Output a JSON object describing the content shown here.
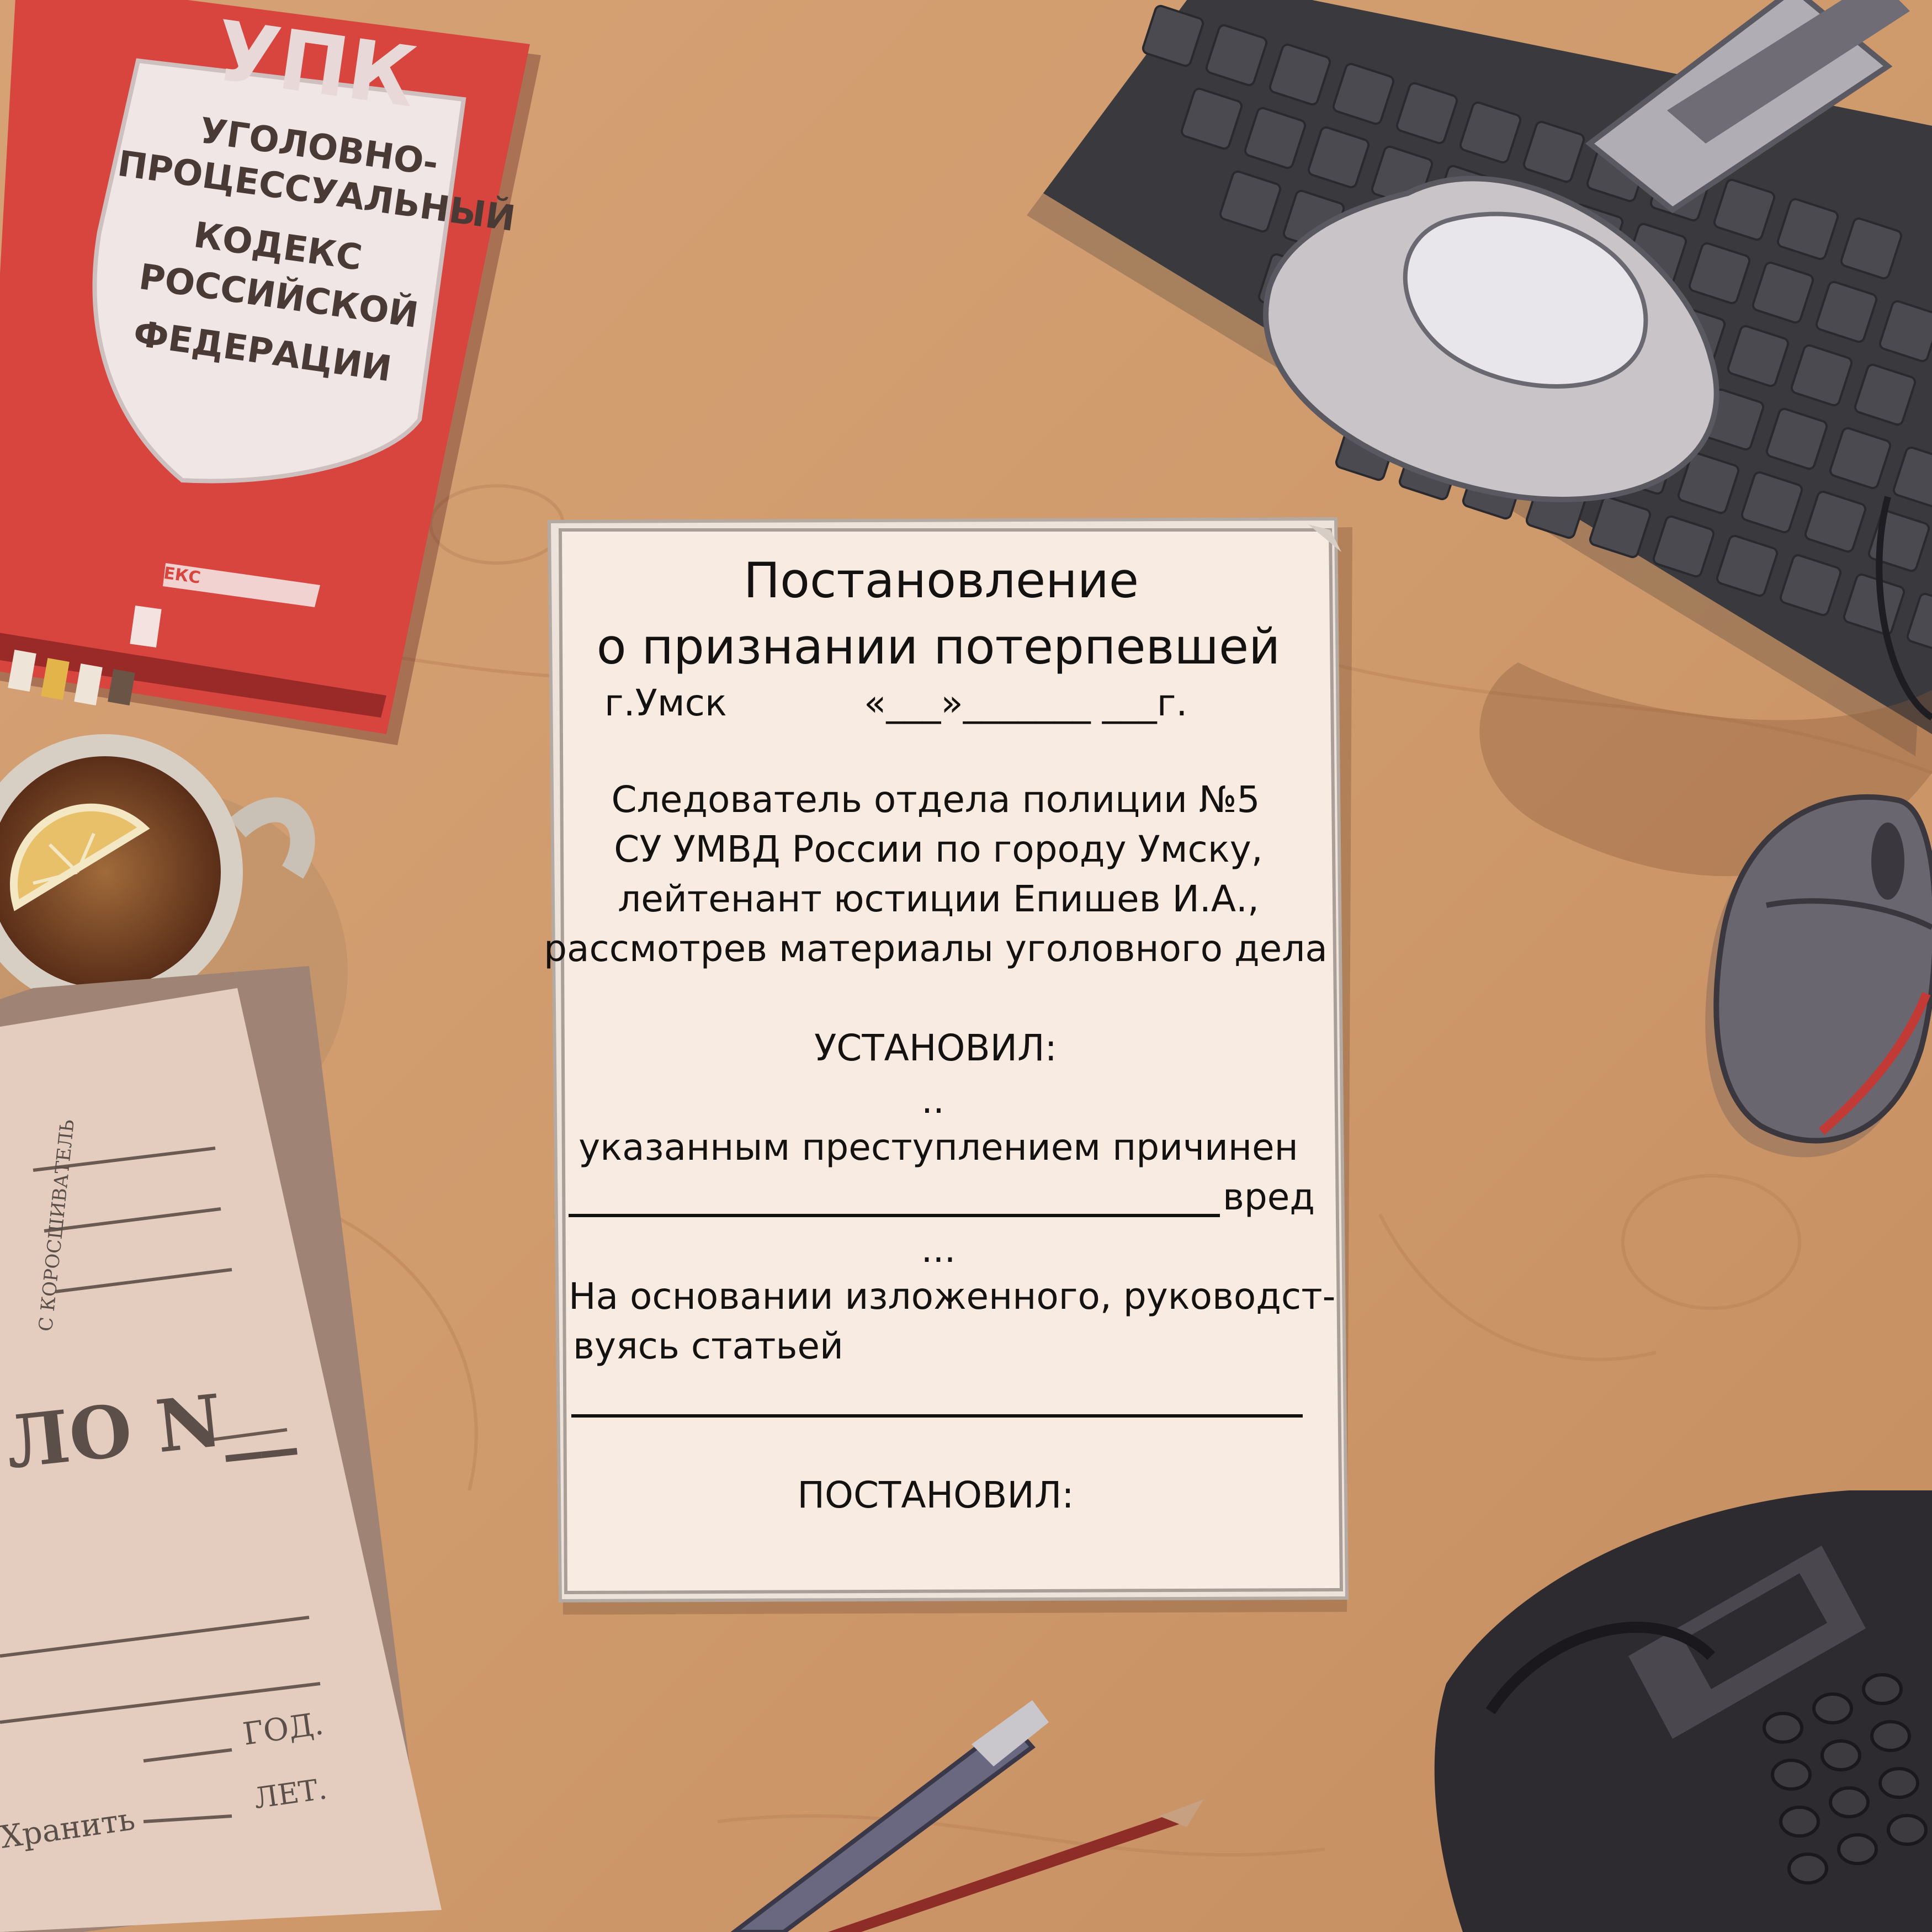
{
  "document": {
    "title_line1": "Постановление",
    "title_line2": "о признании потерпевшей",
    "city": "г.Умск",
    "date_template": "«___»_______ ___г.",
    "intro_lines": [
      "Следователь отдела полиции №5",
      "СУ УМВД России по городу Умску,",
      "лейтенант юстиции Епишев И.А.,",
      "рассмотрев материалы уголовного дела"
    ],
    "established_heading": "УСТАНОВИЛ:",
    "ellipsis_short": "..",
    "harm_line": "указанным преступлением причинен",
    "harm_word": "вред",
    "ellipsis_long": "...",
    "basis_line1": "На основании изложенного, руководст-",
    "basis_line2": "вуясь статьей",
    "decreed_heading": "ПОСТАНОВИЛ:"
  },
  "codebook": {
    "abbr": "УПК",
    "title_lines": [
      "УГОЛОВНО-",
      "ПРОЦЕССУАЛЬНЫЙ",
      "КОДЕКС",
      "РОССИЙСКОЙ",
      "ФЕДЕРАЦИИ"
    ],
    "publisher": "КОДЕКС"
  },
  "folder": {
    "side_text": "С КОРОСШИВАТЕЛЬ",
    "number_label": "ЛО N__",
    "year_label": "ГОД.",
    "years_label": "ЛЕТ.",
    "keep_label": "Хранить"
  },
  "colors": {
    "desk": "#cf9a6c",
    "paper": "#f8ece2",
    "book_red": "#d8443e",
    "keyboard": "#3a3a3e",
    "ink": "#141210"
  }
}
